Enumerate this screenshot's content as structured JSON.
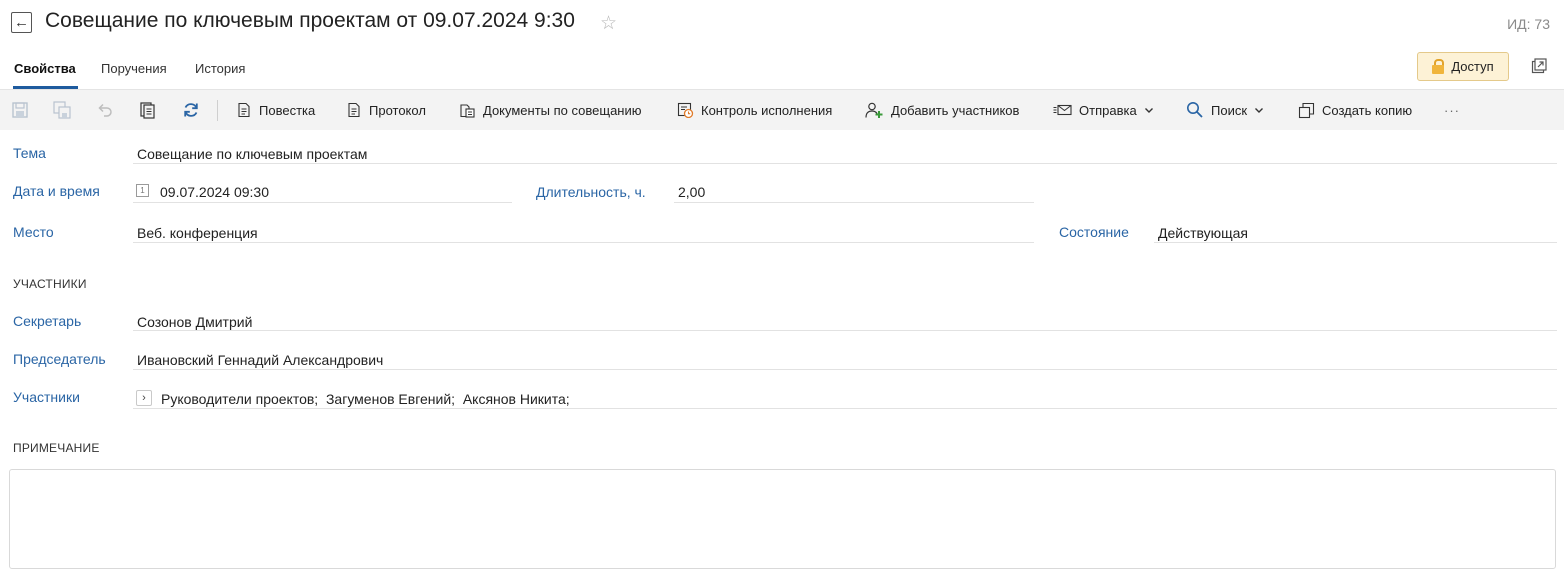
{
  "header": {
    "back_symbol": "←",
    "title": "Совещание по ключевым проектам от 09.07.2024 9:30",
    "favorite_symbol": "☆",
    "id_label": "ИД: 73"
  },
  "tabs": [
    {
      "label": "Свойства",
      "active": true
    },
    {
      "label": "Поручения",
      "active": false
    },
    {
      "label": "История",
      "active": false
    }
  ],
  "access_button": {
    "label": "Доступ"
  },
  "toolbar": {
    "icons": [
      "save-icon",
      "save-as-icon",
      "undo-icon",
      "clipboard-icon",
      "refresh-icon"
    ],
    "buttons": {
      "agenda": "Повестка",
      "protocol": "Протокол",
      "documents": "Документы по совещанию",
      "control": "Контроль исполнения",
      "add_participants": "Добавить участников",
      "send": "Отправка",
      "search": "Поиск",
      "copy": "Создать копию",
      "more": "···"
    }
  },
  "form": {
    "topic": {
      "label": "Тема",
      "value": "Совещание по ключевым проектам"
    },
    "datetime": {
      "label": "Дата и время",
      "value": "09.07.2024 09:30"
    },
    "duration": {
      "label": "Длительность, ч.",
      "value": "2,00"
    },
    "place": {
      "label": "Место",
      "value": "Веб. конференция"
    },
    "state": {
      "label": "Состояние",
      "value": "Действующая"
    }
  },
  "participants_section": {
    "title": "УЧАСТНИКИ",
    "secretary": {
      "label": "Секретарь",
      "value": "Созонов Дмитрий"
    },
    "chairman": {
      "label": "Председатель",
      "value": "Ивановский Геннадий Александрович"
    },
    "participants": {
      "label": "Участники",
      "value": "Руководители проектов;  Загуменов Евгений;  Аксянов Никита;"
    }
  },
  "note_section": {
    "title": "ПРИМЕЧАНИЕ",
    "value": ""
  },
  "colors": {
    "accent_blue": "#2a65a5",
    "tab_underline": "#1e5b9e",
    "access_bg": "#fdf2d6",
    "toolbar_bg": "#f3f3f3"
  }
}
